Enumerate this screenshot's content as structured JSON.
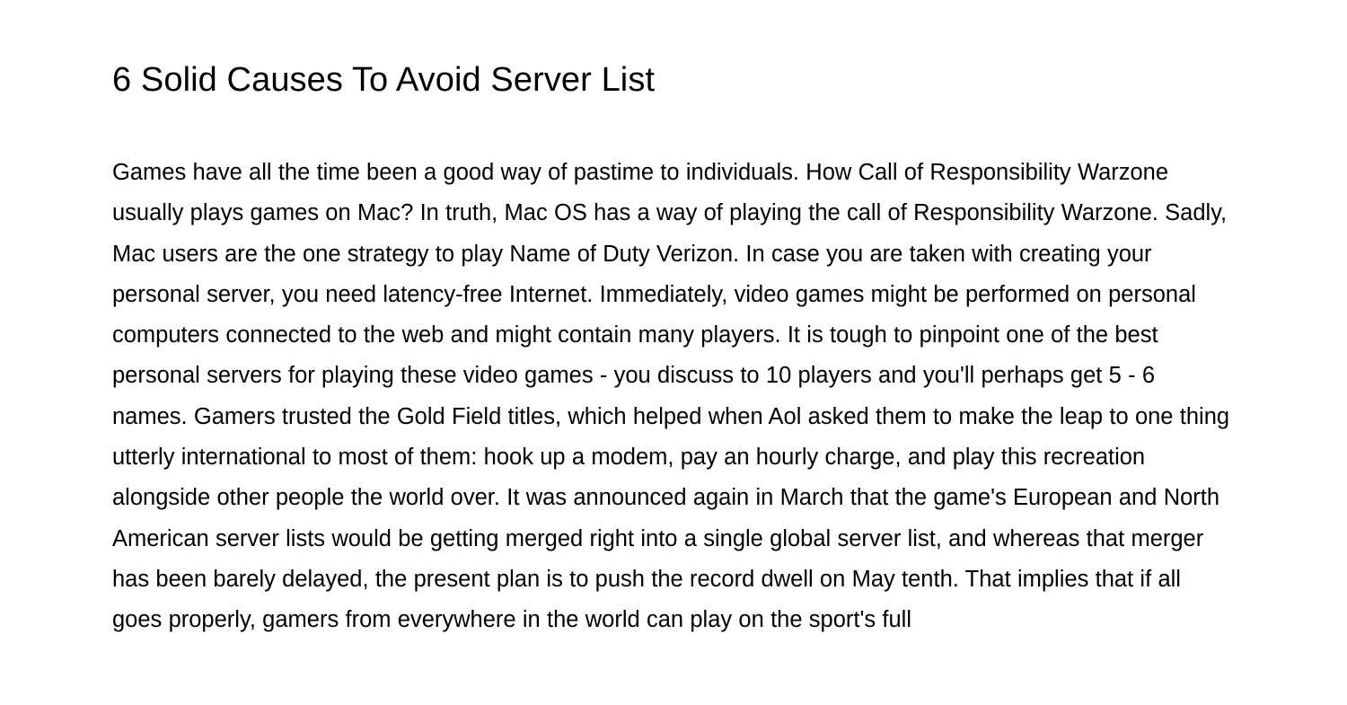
{
  "document": {
    "title": "6 Solid Causes To Avoid Server List",
    "body": "Games have all the time been a good way of pastime to individuals. How Call of Responsibility Warzone usually plays games on Mac? In truth, Mac OS has a way of playing the call of Responsibility Warzone. Sadly, Mac users are the one strategy to play Name of Duty Verizon. In case you are taken with creating your personal server, you need latency-free Internet. Immediately, video games might be performed on personal computers connected to the web and might contain many players. It is tough to pinpoint one of the best personal servers for playing these video games - you discuss to 10 players and you'll perhaps get 5 - 6 names. Gamers trusted the Gold Field titles, which helped when Aol asked them to make the leap to one thing utterly international to most of them: hook up a modem, pay an hourly charge, and play this recreation alongside other people the world over. It was announced again in March that the game's European and North American server lists would be getting merged right into a single global server list, and whereas that merger has been barely delayed, the present plan is to push the record dwell on May tenth. That implies that if all goes properly, gamers from everywhere in the world can play on the sport's full"
  },
  "colors": {
    "page_background": "#ffffff",
    "text": "#000000"
  }
}
